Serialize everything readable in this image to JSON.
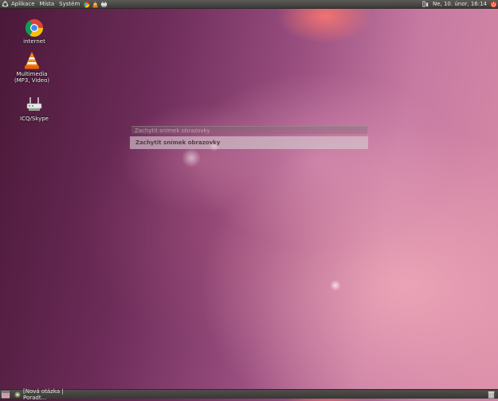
{
  "top_panel": {
    "menus": [
      "Aplikace",
      "Místa",
      "Systém"
    ],
    "clock": "Ne, 10. únor, 16:14"
  },
  "desktop": {
    "icons": [
      {
        "label": "internet",
        "icon": "chrome-icon"
      },
      {
        "label": "Multimedia (MP3, Video)",
        "icon": "vlc-icon"
      },
      {
        "label": "ICQ/Skype",
        "icon": "router-icon"
      }
    ]
  },
  "dialog": {
    "title": "Zachytit snímek obrazovky",
    "bar_label": "Zachytit snímek obrazovky"
  },
  "bottom_panel": {
    "task": "[Nová otázka | Poradt..."
  },
  "colors": {
    "panel": "#3b3a37",
    "accent": "#e0532a"
  }
}
